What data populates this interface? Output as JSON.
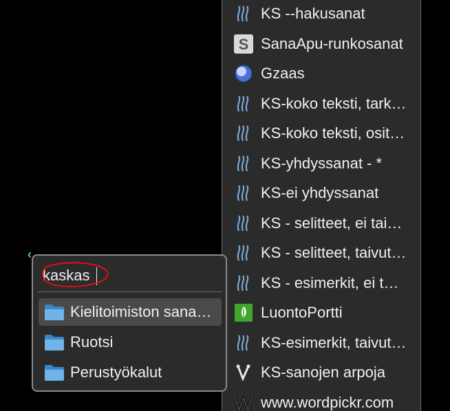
{
  "search": {
    "value": "kaskas"
  },
  "folders": [
    {
      "label": "Kielitoimiston sanakirja",
      "selected": true
    },
    {
      "label": "Ruotsi",
      "selected": false
    },
    {
      "label": "Perustyökalut",
      "selected": false
    }
  ],
  "engines": [
    {
      "label": "KS --hakusanat",
      "icon": "ks-wave-icon"
    },
    {
      "label": "SanaApu-runkosanat",
      "icon": "s-logo-icon"
    },
    {
      "label": "Gzaas",
      "icon": "globe-icon"
    },
    {
      "label": "KS-koko teksti, tarkka",
      "icon": "ks-wave-icon"
    },
    {
      "label": "KS-koko teksti, osittainen",
      "icon": "ks-wave-icon"
    },
    {
      "label": "KS-yhdyssanat - *",
      "icon": "ks-wave-icon"
    },
    {
      "label": "KS-ei yhdyssanat",
      "icon": "ks-wave-icon"
    },
    {
      "label": "KS - selitteet, ei taivutus",
      "icon": "ks-wave-icon"
    },
    {
      "label": "KS - selitteet, taivutus",
      "icon": "ks-wave-icon"
    },
    {
      "label": "KS - esimerkit, ei taivutus",
      "icon": "ks-wave-icon"
    },
    {
      "label": "LuontoPortti",
      "icon": "luontoportti-icon"
    },
    {
      "label": "KS-esimerkit, taivutus",
      "icon": "ks-wave-icon"
    },
    {
      "label": "KS-sanojen arpoja",
      "icon": "v-logo-icon"
    },
    {
      "label": "www.wordpickr.com",
      "icon": "wordpickr-icon"
    }
  ],
  "colors": {
    "menu_bg": "#2b2b2b",
    "ks_icon": "#7aa8d6",
    "selected_bg": "#4a4a4a",
    "annotation_red": "#e01010",
    "popup_arrow": "#6bd36b"
  }
}
